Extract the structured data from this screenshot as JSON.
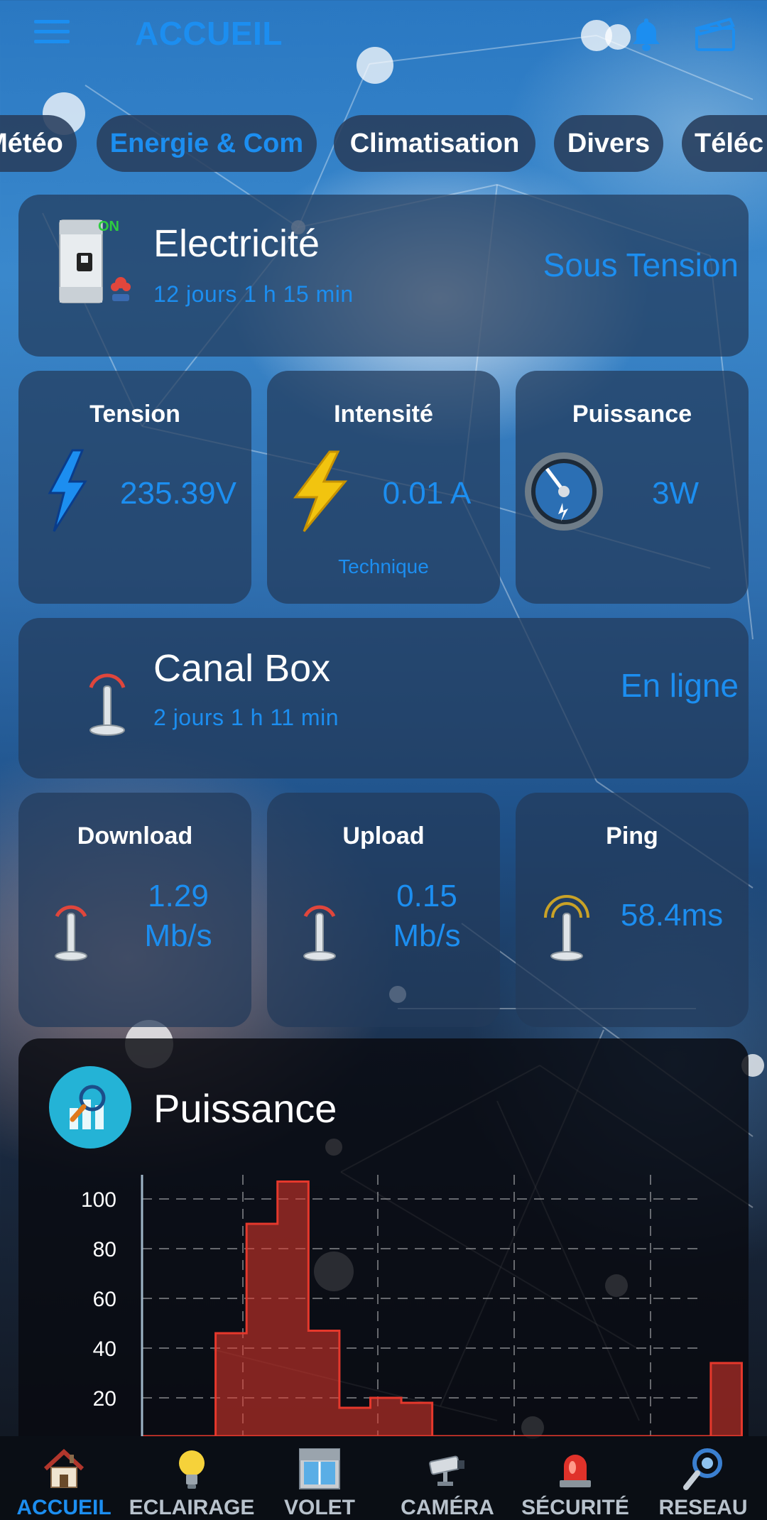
{
  "header": {
    "title": "ACCUEIL"
  },
  "tabs": [
    {
      "label": "Météo",
      "active": false
    },
    {
      "label": "Energie & Com",
      "active": true
    },
    {
      "label": "Climatisation",
      "active": false
    },
    {
      "label": "Divers",
      "active": false
    },
    {
      "label": "Téléc",
      "active": false
    }
  ],
  "electricity": {
    "badge": "ON",
    "title": "Electricité",
    "uptime": "12 jours 1 h 15 min",
    "status": "Sous Tension"
  },
  "power_metrics": [
    {
      "title": "Tension",
      "value": "235.39V",
      "caption": ""
    },
    {
      "title": "Intensité",
      "value": "0.01 A",
      "caption": "Technique"
    },
    {
      "title": "Puissance",
      "value": "3W",
      "caption": ""
    }
  ],
  "box": {
    "title": "Canal Box",
    "uptime": "2 jours 1 h 11 min",
    "status": "En ligne"
  },
  "net_metrics": [
    {
      "title": "Download",
      "value_line1": "1.29",
      "value_line2": "Mb/s"
    },
    {
      "title": "Upload",
      "value_line1": "0.15",
      "value_line2": "Mb/s"
    },
    {
      "title": "Ping",
      "value_line1": "58.4ms",
      "value_line2": ""
    }
  ],
  "chart_section": {
    "title": "Puissance"
  },
  "chart_data": {
    "type": "area",
    "title": "Puissance",
    "xlabel": "",
    "ylabel": "",
    "ylim": [
      0,
      110
    ],
    "y_ticks": [
      "100",
      "80",
      "60",
      "40",
      "20"
    ],
    "grid": true,
    "series": [
      {
        "color": "#e5382c",
        "x": [
          0,
          1,
          2,
          3,
          4,
          5,
          6,
          7,
          8,
          9,
          10,
          11,
          12,
          13,
          14,
          15,
          16,
          17
        ],
        "values": [
          0,
          46,
          90,
          107,
          47,
          16,
          20,
          18,
          0,
          0,
          0,
          0,
          0,
          0,
          0,
          0,
          1,
          34
        ]
      }
    ]
  },
  "bottom_nav": [
    {
      "label": "ACCUEIL",
      "icon": "house-icon",
      "active": true
    },
    {
      "label": "ECLAIRAGE",
      "icon": "lightbulb-icon",
      "active": false
    },
    {
      "label": "VOLET",
      "icon": "window-shutter-icon",
      "active": false
    },
    {
      "label": "CAMÉRA",
      "icon": "camera-icon",
      "active": false
    },
    {
      "label": "SÉCURITÉ",
      "icon": "alarm-siren-icon",
      "active": false
    },
    {
      "label": "RESEAU",
      "icon": "network-icon",
      "active": false
    }
  ],
  "colors": {
    "accent": "#1c8ef0",
    "on_green": "#2ecc40",
    "chart_red": "#e5382c"
  }
}
